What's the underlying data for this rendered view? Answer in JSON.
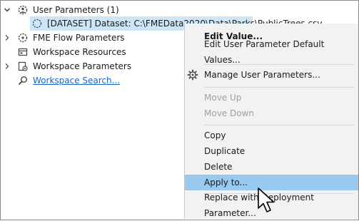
{
  "tree": {
    "user_parameters": "User Parameters (1)",
    "dataset_item": "[DATASET] Dataset: C:\\FMEData2020\\Data\\Parks\\PublicTrees.csv",
    "fme_flow_parameters": "FME Flow Parameters",
    "workspace_resources": "Workspace Resources",
    "workspace_parameters": "Workspace Parameters",
    "workspace_search": "Workspace Search..."
  },
  "context_menu": {
    "edit_value": "Edit Value...",
    "edit_default": "Edit User Parameter Default Values...",
    "manage": "Manage User Parameters...",
    "move_up": "Move Up",
    "move_down": "Move Down",
    "copy": "Copy",
    "duplicate": "Duplicate",
    "delete": "Delete",
    "apply_to": "Apply to...",
    "replace": "Replace with Deployment Parameter..."
  },
  "colors": {
    "selection": "#cde6f7",
    "menu_hover": "#99c9ef",
    "link": "#1a66c4"
  }
}
